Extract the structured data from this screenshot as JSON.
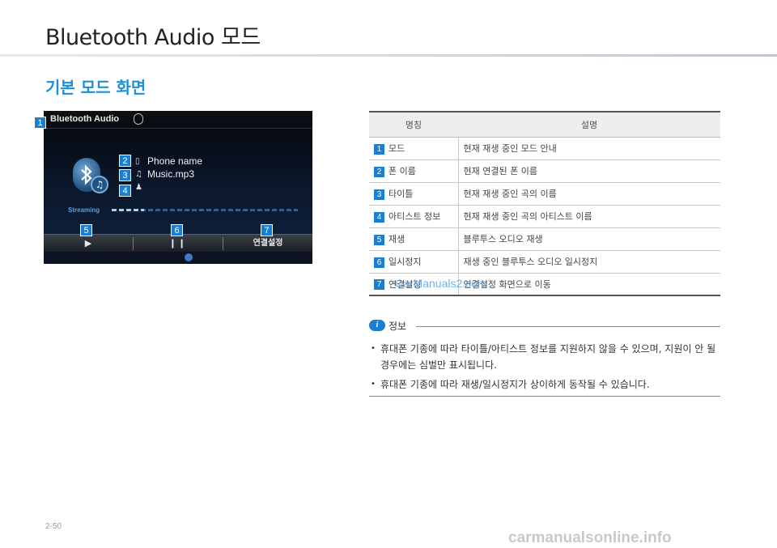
{
  "header": {
    "title": "Bluetooth Audio 모드",
    "section_title": "기본 모드 화면"
  },
  "screen": {
    "title": "Bluetooth Audio",
    "phone_name": "Phone name",
    "track": "Music.mp3",
    "status": "Streaming",
    "connect_button": "연결설정",
    "badges": [
      "1",
      "2",
      "3",
      "4",
      "5",
      "6",
      "7"
    ]
  },
  "table": {
    "headers": [
      "명칭",
      "설명"
    ],
    "rows": [
      {
        "num": "1",
        "name": "모드",
        "desc": "현재 재생 중인 모드 안내"
      },
      {
        "num": "2",
        "name": "폰 이름",
        "desc": "현재 연결된 폰 이름"
      },
      {
        "num": "3",
        "name": "타이틀",
        "desc": "현재 재생 중인 곡의 이름"
      },
      {
        "num": "4",
        "name": "아티스트 정보",
        "desc": "현재 재생 중인 곡의 아티스트 이름"
      },
      {
        "num": "5",
        "name": "재생",
        "desc": "블루투스 오디오 재생"
      },
      {
        "num": "6",
        "name": "일시정지",
        "desc": "재생 중인 블루투스 오디오 일시정지"
      },
      {
        "num": "7",
        "name": "연결설정",
        "desc": "연결설정 화면으로 이동"
      }
    ]
  },
  "watermark": "CarManuals2.com",
  "info": {
    "icon": "i",
    "label": "정보",
    "items": [
      "휴대폰 기종에 따라 타이틀/아티스트 정보를 지원하지 않을 수 있으며, 지원이 안 될 경우에는 심벌만 표시됩니다.",
      "휴대폰 기종에 따라 재생/일시정지가 상이하게 동작될 수 있습니다."
    ]
  },
  "footer": {
    "page_number": "2-50",
    "site": "carmanualsonline.info"
  },
  "colors": {
    "accent": "#1a7fd0",
    "section_title": "#1f8fd6"
  }
}
